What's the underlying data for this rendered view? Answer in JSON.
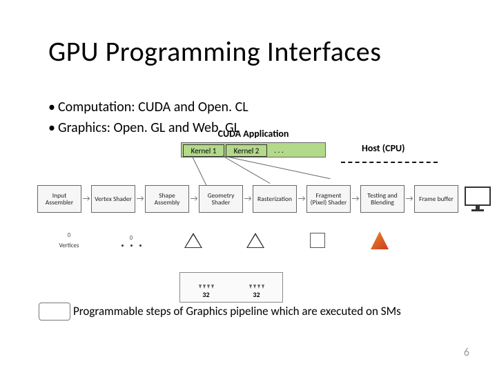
{
  "title": "GPU Programming Interfaces",
  "bullets": [
    "Computation: CUDA and Open. CL",
    "Graphics: Open. GL and Web. GL"
  ],
  "cuda": {
    "app_label": "CUDA Application",
    "kernels": [
      "Kernel 1",
      "Kernel 2",
      ". . ."
    ],
    "host_label": "Host (CPU)"
  },
  "pipeline": {
    "stages": [
      "Input Assembler",
      "Vertex Shader",
      "Shape Assembly",
      "Geometry Shader",
      "Rasterization",
      "Fragment (Pixel) Shader",
      "Testing and Blending",
      "Frame buffer"
    ]
  },
  "mini": {
    "vertices_label": "Vertices",
    "tick0": "0",
    "sm_count": "32"
  },
  "caption": "Programmable steps of Graphics pipeline which are executed on SMs",
  "page_number": "6"
}
